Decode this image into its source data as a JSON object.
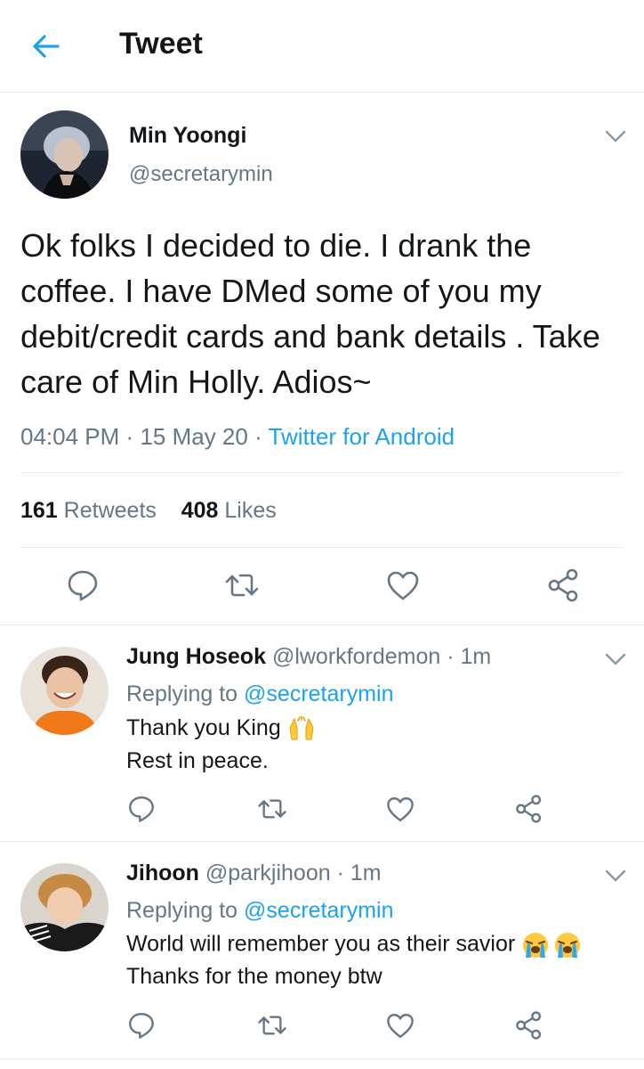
{
  "header": {
    "title": "Tweet"
  },
  "tweet": {
    "author_name": "Min Yoongi",
    "author_handle": "@secretarymin",
    "text": "Ok folks I decided to die. I drank the coffee. I have DMed some of you my debit/credit cards and bank details . Take care of Min Holly. Adios~",
    "time": "04:04 PM",
    "date": "15 May 20",
    "source": "Twitter for Android",
    "separator": "·",
    "retweet_count": "161",
    "retweet_label": "Retweets",
    "like_count": "408",
    "like_label": "Likes"
  },
  "replies": [
    {
      "name": "Jung Hoseok",
      "handle": "@lworkfordemon",
      "time": "1m",
      "replying_prefix": "Replying to",
      "replying_to": "@secretarymin",
      "line1": "Thank you King",
      "line2": "Rest in peace.",
      "emoji": "raising-hands"
    },
    {
      "name": "Jihoon",
      "handle": "@parkjihoon",
      "time": "1m",
      "replying_prefix": "Replying to",
      "replying_to": "@secretarymin",
      "line1": "World will remember you as their savior",
      "line2": "Thanks for the money btw",
      "emoji": "loudly-crying-face"
    }
  ],
  "icons": [
    "back-arrow-icon",
    "chevron-down-icon",
    "reply-icon",
    "retweet-icon",
    "like-icon",
    "share-icon"
  ],
  "colors": {
    "accent": "#1da1f2",
    "secondary_text": "#657786",
    "divider": "#e6ecf0"
  }
}
